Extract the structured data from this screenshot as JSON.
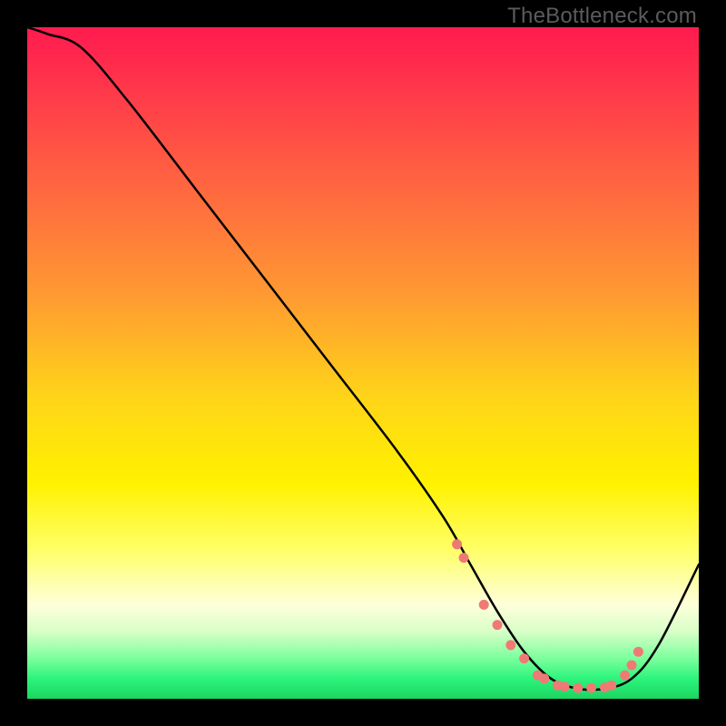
{
  "watermark": "TheBottleneck.com",
  "colors": {
    "background": "#000000",
    "curve": "#000000",
    "marker": "#ef7a75"
  },
  "chart_data": {
    "type": "line",
    "title": "",
    "xlabel": "",
    "ylabel": "",
    "xlim": [
      0,
      100
    ],
    "ylim": [
      0,
      100
    ],
    "grid": false,
    "legend": false,
    "series": [
      {
        "name": "bottleneck-curve",
        "x": [
          0,
          3,
          8,
          15,
          25,
          35,
          45,
          55,
          62,
          66,
          70,
          74,
          78,
          82,
          86,
          90,
          94,
          100
        ],
        "y": [
          100,
          99,
          97,
          89,
          76,
          63,
          50,
          37,
          27,
          20,
          13,
          7,
          3,
          1.5,
          1.5,
          3,
          8,
          20
        ]
      }
    ],
    "markers": {
      "name": "highlight-dots",
      "x": [
        64,
        65,
        68,
        70,
        72,
        74,
        76,
        77,
        79,
        80,
        82,
        84,
        86,
        87,
        89,
        90,
        91
      ],
      "y": [
        23,
        21,
        14,
        11,
        8,
        6,
        3.5,
        3,
        2,
        1.8,
        1.6,
        1.6,
        1.7,
        2,
        3.5,
        5,
        7
      ]
    }
  }
}
